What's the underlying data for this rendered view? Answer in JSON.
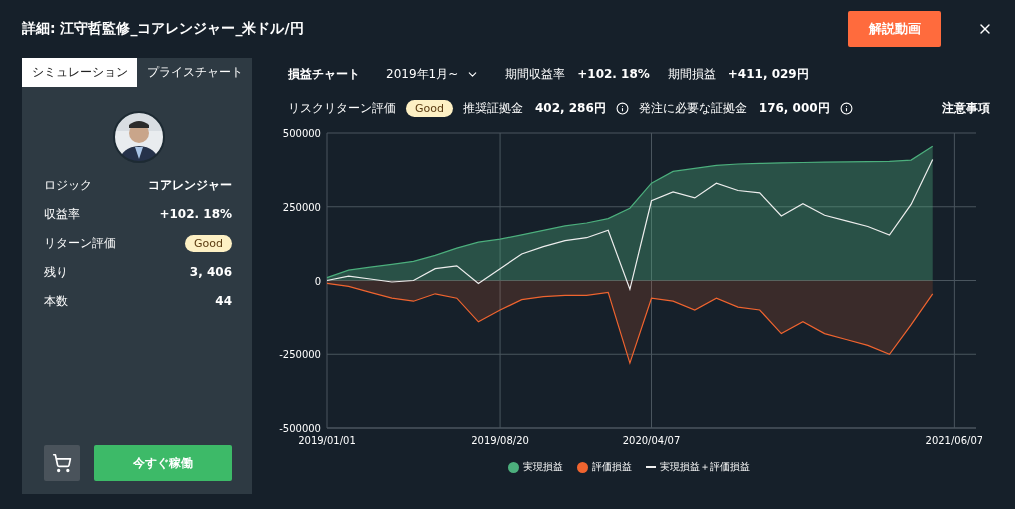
{
  "title": "詳細: 江守哲監修_コアレンジャー_米ドル/円",
  "video_button": "解説動画",
  "tabs": [
    {
      "label": "シミュレーション",
      "selected": true
    },
    {
      "label": "プライスチャート",
      "selected": false
    }
  ],
  "profile": {
    "rows": [
      {
        "label": "ロジック",
        "value": "コアレンジャー",
        "kind": "text"
      },
      {
        "label": "収益率",
        "value": "+102. 18%",
        "kind": "text"
      },
      {
        "label": "リターン評価",
        "value": "Good",
        "kind": "badge"
      },
      {
        "label": "残り",
        "value": "3, 406",
        "kind": "text"
      },
      {
        "label": "本数",
        "value": "44",
        "kind": "text"
      }
    ],
    "start_button": "今すぐ稼働"
  },
  "summary": {
    "chart_title": "損益チャート",
    "period": "2019年1月~",
    "stats": [
      {
        "label": "期間収益率",
        "value": "+102. 18%"
      },
      {
        "label": "期間損益",
        "value": "+411, 029円"
      }
    ]
  },
  "risk": {
    "label": "リスクリターン評価",
    "badge": "Good",
    "margins": [
      {
        "label": "推奨証拠金",
        "value": "402, 286円"
      },
      {
        "label": "発注に必要な証拠金",
        "value": "176, 000円"
      }
    ],
    "notes_link": "注意事項"
  },
  "chart_data": {
    "type": "area",
    "grid": true,
    "categories": [
      "2019/01/01",
      null,
      null,
      null,
      null,
      null,
      null,
      null,
      "2019/08/20",
      null,
      null,
      null,
      null,
      null,
      null,
      "2020/04/07",
      null,
      null,
      null,
      null,
      null,
      null,
      null,
      null,
      null,
      null,
      null,
      null,
      null,
      "2021/06/07",
      null
    ],
    "ylim": [
      -500000,
      500000
    ],
    "yticks": [
      -500000,
      -250000,
      0,
      250000,
      500000
    ],
    "series": [
      {
        "name": "実現損益",
        "type": "area",
        "color": "#4caf7d",
        "values": [
          10000,
          35000,
          45000,
          55000,
          65000,
          85000,
          110000,
          130000,
          140000,
          155000,
          170000,
          185000,
          195000,
          210000,
          245000,
          330000,
          370000,
          380000,
          390000,
          395000,
          397000,
          399000,
          400000,
          401000,
          402000,
          403000,
          404000,
          408000,
          455000,
          null,
          null
        ]
      },
      {
        "name": "評価損益",
        "type": "area",
        "color": "#f0642f",
        "values": [
          -10000,
          -20000,
          -40000,
          -60000,
          -70000,
          -45000,
          -60000,
          -140000,
          -100000,
          -65000,
          -55000,
          -50000,
          -50000,
          -40000,
          -280000,
          -60000,
          -70000,
          -100000,
          -60000,
          -90000,
          -100000,
          -180000,
          -140000,
          -180000,
          -200000,
          -220000,
          -250000,
          -150000,
          -45000,
          null,
          null
        ]
      },
      {
        "name": "実現損益＋評価損益",
        "type": "line",
        "color": "#eeeeee",
        "values": [
          0,
          15000,
          5000,
          -5000,
          0,
          40000,
          50000,
          -10000,
          40000,
          90000,
          115000,
          135000,
          145000,
          170000,
          -30000,
          270000,
          300000,
          280000,
          330000,
          305000,
          297000,
          219000,
          260000,
          221000,
          202000,
          183000,
          154000,
          258000,
          410000,
          null,
          null
        ]
      }
    ]
  }
}
